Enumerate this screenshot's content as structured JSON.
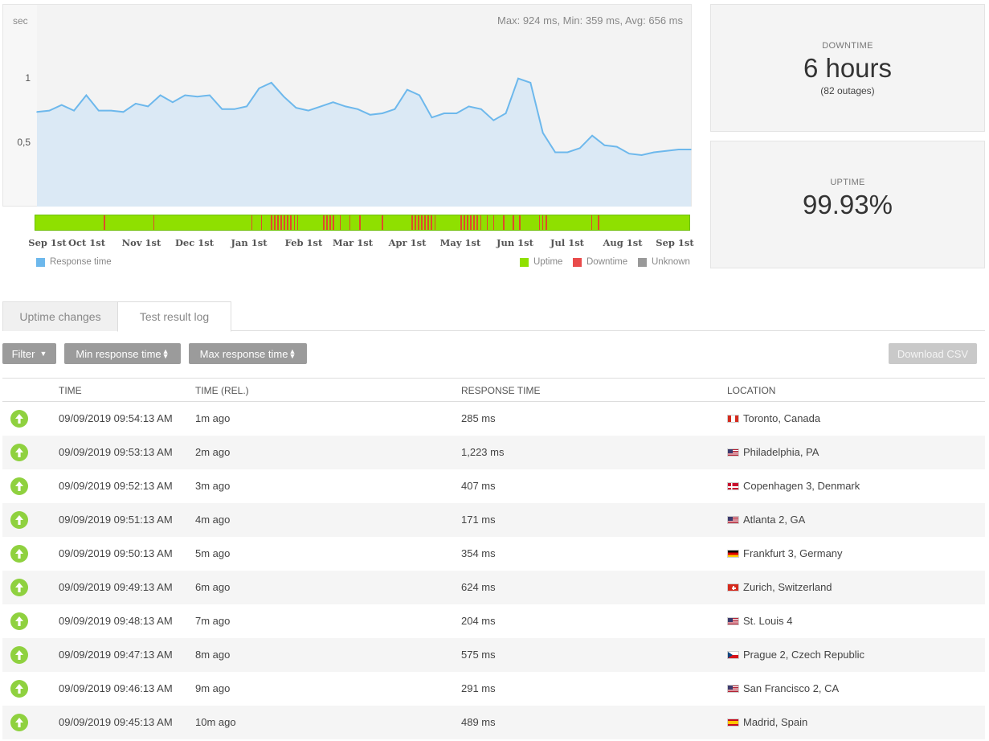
{
  "chart": {
    "stats_text": "Max: 924 ms, Min: 359 ms, Avg: 656 ms",
    "y_unit": "sec",
    "y_ticks": [
      "1",
      "0,5"
    ],
    "x_ticks": [
      "Sep 1st",
      "Oct 1st",
      "Nov 1st",
      "Dec 1st",
      "Jan 1st",
      "Feb 1st",
      "Mar 1st",
      "Apr 1st",
      "May 1st",
      "Jun 1st",
      "Jul 1st",
      "Aug 1st",
      "Sep 1st"
    ],
    "legend_left": "Response time",
    "legend_right": [
      "Uptime",
      "Downtime",
      "Unknown"
    ],
    "colors": {
      "line": "#6db8ec",
      "fill": "#dbe9f5",
      "uptime": "#8fe000",
      "downtime": "#e94b4b",
      "unknown": "#999999"
    }
  },
  "chart_data": {
    "type": "area",
    "series": [
      {
        "name": "Response time",
        "values": [
          0.68,
          0.69,
          0.73,
          0.69,
          0.8,
          0.69,
          0.69,
          0.68,
          0.74,
          0.72,
          0.8,
          0.75,
          0.8,
          0.79,
          0.8,
          0.7,
          0.7,
          0.72,
          0.85,
          0.89,
          0.79,
          0.71,
          0.69,
          0.72,
          0.75,
          0.72,
          0.7,
          0.66,
          0.67,
          0.7,
          0.84,
          0.8,
          0.64,
          0.67,
          0.67,
          0.72,
          0.7,
          0.62,
          0.67,
          0.92,
          0.89,
          0.53,
          0.39,
          0.39,
          0.42,
          0.51,
          0.44,
          0.43,
          0.38,
          0.37,
          0.39,
          0.4,
          0.41,
          0.41
        ]
      }
    ],
    "ylim": [
      0,
      1.45
    ],
    "grid": false,
    "status": {
      "uptime": "#8fe000",
      "downtime_positions": [
        0.105,
        0.18,
        0.33,
        0.345,
        0.36,
        0.365,
        0.37,
        0.375,
        0.38,
        0.385,
        0.39,
        0.395,
        0.4,
        0.44,
        0.445,
        0.45,
        0.455,
        0.465,
        0.48,
        0.495,
        0.53,
        0.575,
        0.58,
        0.585,
        0.59,
        0.595,
        0.6,
        0.605,
        0.61,
        0.65,
        0.655,
        0.66,
        0.665,
        0.67,
        0.675,
        0.68,
        0.69,
        0.7,
        0.715,
        0.73,
        0.74,
        0.77,
        0.775,
        0.78,
        0.85,
        0.86
      ]
    }
  },
  "cards": {
    "downtime": {
      "label": "DOWNTIME",
      "value": "6 hours",
      "sub": "(82 outages)"
    },
    "uptime": {
      "label": "UPTIME",
      "value": "99.93%"
    }
  },
  "tabs": [
    "Uptime changes",
    "Test result log"
  ],
  "toolbar": {
    "filter": "Filter",
    "min_response": "Min response time",
    "max_response": "Max response time",
    "download": "Download CSV"
  },
  "table": {
    "headers": [
      "TIME",
      "TIME (REL.)",
      "RESPONSE TIME",
      "LOCATION"
    ],
    "rows": [
      {
        "time": "09/09/2019 09:54:13 AM",
        "rel": "1m ago",
        "response": "285 ms",
        "location": "Toronto, Canada",
        "flag": "canada-flag-icon"
      },
      {
        "time": "09/09/2019 09:53:13 AM",
        "rel": "2m ago",
        "response": "1,223 ms",
        "location": "Philadelphia, PA",
        "flag": "us-flag-icon"
      },
      {
        "time": "09/09/2019 09:52:13 AM",
        "rel": "3m ago",
        "response": "407 ms",
        "location": "Copenhagen 3, Denmark",
        "flag": "denmark-flag-icon"
      },
      {
        "time": "09/09/2019 09:51:13 AM",
        "rel": "4m ago",
        "response": "171 ms",
        "location": "Atlanta 2, GA",
        "flag": "us-flag-icon"
      },
      {
        "time": "09/09/2019 09:50:13 AM",
        "rel": "5m ago",
        "response": "354 ms",
        "location": "Frankfurt 3, Germany",
        "flag": "germany-flag-icon"
      },
      {
        "time": "09/09/2019 09:49:13 AM",
        "rel": "6m ago",
        "response": "624 ms",
        "location": "Zurich, Switzerland",
        "flag": "switzerland-flag-icon"
      },
      {
        "time": "09/09/2019 09:48:13 AM",
        "rel": "7m ago",
        "response": "204 ms",
        "location": "St. Louis 4",
        "flag": "us-flag-icon"
      },
      {
        "time": "09/09/2019 09:47:13 AM",
        "rel": "8m ago",
        "response": "575 ms",
        "location": "Prague 2, Czech Republic",
        "flag": "czech-flag-icon"
      },
      {
        "time": "09/09/2019 09:46:13 AM",
        "rel": "9m ago",
        "response": "291 ms",
        "location": "San Francisco 2, CA",
        "flag": "us-flag-icon"
      },
      {
        "time": "09/09/2019 09:45:13 AM",
        "rel": "10m ago",
        "response": "489 ms",
        "location": "Madrid, Spain",
        "flag": "spain-flag-icon"
      }
    ]
  }
}
